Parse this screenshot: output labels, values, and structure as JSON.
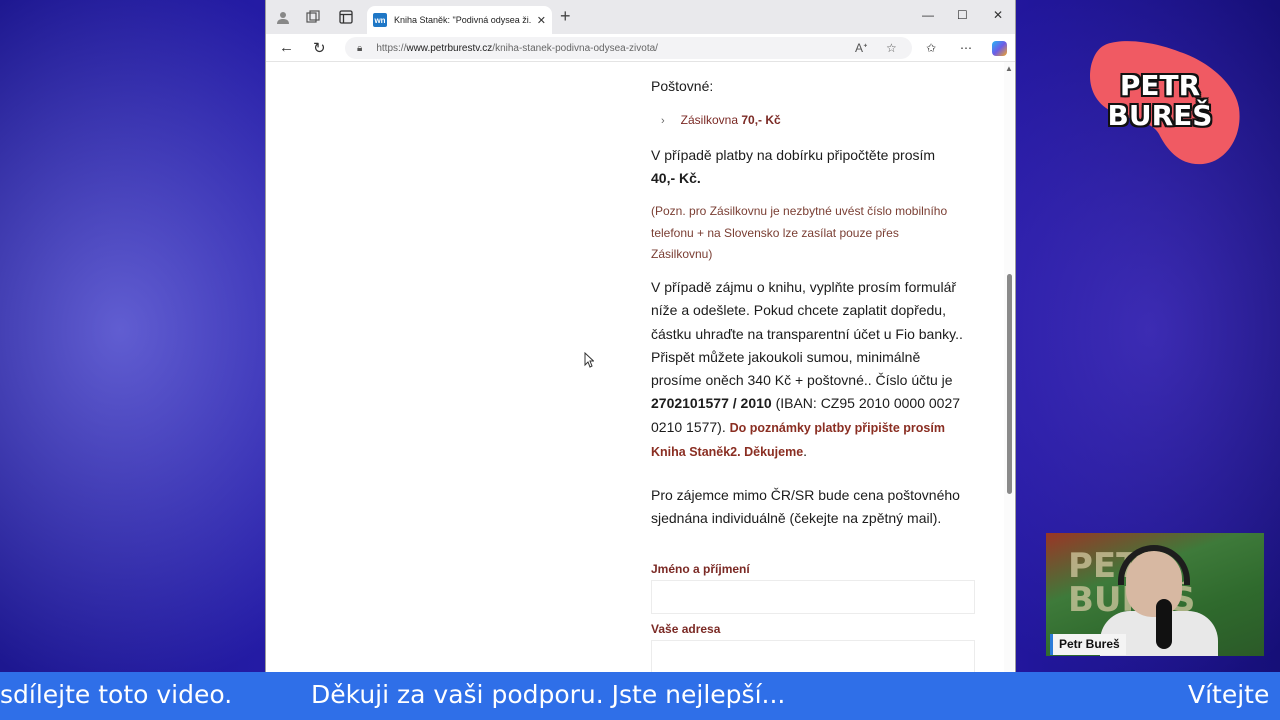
{
  "browser": {
    "tab": {
      "favicon_text": "wn",
      "title": "Kniha Staněk: \"Podivná odysea ži..."
    },
    "url": {
      "prefix": "https://",
      "host": "www.petrburestv.cz",
      "path": "/kniha-stanek-podivna-odysea-zivota/"
    },
    "icons": [
      "profile-icon",
      "workspaces-icon",
      "vertical-tabs-icon",
      "close-icon",
      "new-tab-icon",
      "minimize-icon",
      "maximize-icon",
      "window-close-icon",
      "back-icon",
      "refresh-icon",
      "lock-icon",
      "read-aloud-icon",
      "favorite-icon",
      "favorites-icon",
      "more-icon",
      "copilot-icon"
    ]
  },
  "page": {
    "postovne_label": "Poštovné:",
    "zasilkovna_label": "Zásilkovna ",
    "zasilkovna_price": "70,- Kč",
    "dobirka_text": "V případě platby na dobírku připočtěte prosím ",
    "dobirka_price": "40,- Kč.",
    "pozn_line1": "(Pozn. pro Zásilkovnu je nezbytné uvést číslo mobilního",
    "pozn_line2": "telefonu + na Slovensko lze zasílat pouze přes",
    "pozn_line3": "Zásilkovnu)",
    "zajem_line1": "V případě zájmu o knihu, vyplňte prosím formulář",
    "zajem_line2": "níže a odešlete. Pokud chcete zaplatit dopředu,",
    "zajem_line3": "částku uhraďte na transparentní účet u Fio banky..",
    "zajem_line4": "Přispět můžete jakoukoli sumou, minimálně",
    "zajem_line5": "prosíme oněch 340 Kč + poštovné.. Číslo účtu je",
    "account_number": "2702101577 / 2010",
    "iban_part1": " (IBAN: CZ95 2010 0000 0027",
    "iban_part2": "0210 1577). ",
    "note_red1": "Do poznámky platby připište prosím",
    "note_red2": "Kniha Staněk2. Děkujeme",
    "note_end": ".",
    "mimo_line1": "Pro zájemce mimo ČR/SR bude cena poštovného",
    "mimo_line2": "sjednána individuálně (čekejte na zpětný mail).",
    "field_name_label": "Jméno a příjmení",
    "field_address_label": "Vaše adresa",
    "field_name_value": "",
    "field_address_value": ""
  },
  "overlay": {
    "logo_line1": "PETR",
    "logo_line2": "BUREŠ",
    "logo_color": "#f05a63",
    "webcam_bg_text1": "PETR",
    "webcam_bg_text2": "BUREŠ",
    "webcam_name": "Petr Bureš",
    "ticker": [
      "sdílejte toto video.",
      "Děkuji za vaši podporu. Jste nejlepší...",
      "Vítejte"
    ],
    "ticker_color": "#2f6fe8"
  }
}
